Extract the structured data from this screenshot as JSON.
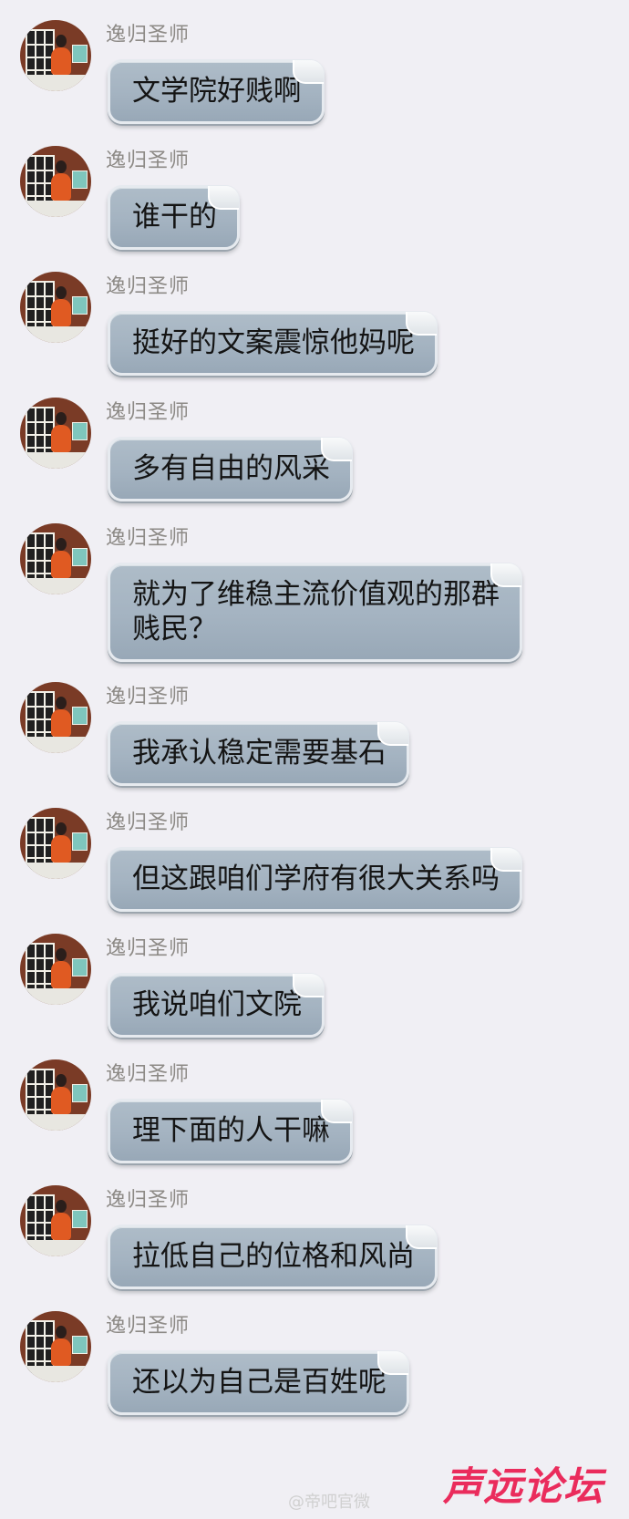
{
  "messages": [
    {
      "sender": "逸归圣师",
      "text": "文学院好贱啊"
    },
    {
      "sender": "逸归圣师",
      "text": "谁干的"
    },
    {
      "sender": "逸归圣师",
      "text": "挺好的文案震惊他妈呢"
    },
    {
      "sender": "逸归圣师",
      "text": "多有自由的风采"
    },
    {
      "sender": "逸归圣师",
      "text_lines": [
        "就为了维稳主流价值观的那群",
        "贱民？"
      ]
    },
    {
      "sender": "逸归圣师",
      "text": "我承认稳定需要基石"
    },
    {
      "sender": "逸归圣师",
      "text": "但这跟咱们学府有很大关系吗"
    },
    {
      "sender": "逸归圣师",
      "text": "我说咱们文院"
    },
    {
      "sender": "逸归圣师",
      "text": "理下面的人干嘛"
    },
    {
      "sender": "逸归圣师",
      "text": "拉低自己的位格和风尚"
    },
    {
      "sender": "逸归圣师",
      "text": "还以为自己是百姓呢"
    }
  ],
  "watermarks": {
    "weibo": "@帝吧官微",
    "logo": "声远论坛"
  }
}
